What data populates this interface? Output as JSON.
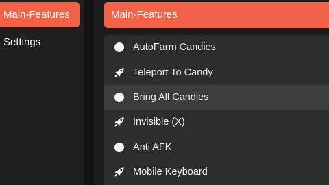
{
  "sidebar": {
    "items": [
      {
        "label": "Main-Features",
        "active": true
      },
      {
        "label": "Settings",
        "active": false
      }
    ]
  },
  "main": {
    "header": "Main-Features",
    "rows": [
      {
        "label": "AutoFarm Candies",
        "icon": "toggle-circle-icon"
      },
      {
        "label": "Teleport To Candy",
        "icon": "rocket-icon"
      },
      {
        "label": "Bring All Candies",
        "icon": "toggle-circle-icon"
      },
      {
        "label": "Invisible (X)",
        "icon": "rocket-icon"
      },
      {
        "label": "Anti AFK",
        "icon": "toggle-circle-icon"
      },
      {
        "label": "Mobile Keyboard",
        "icon": "rocket-icon"
      }
    ]
  },
  "colors": {
    "accent": "#f26248",
    "sidebar_bg": "#1f1f1f",
    "panel_bg": "#2d2d2d",
    "row_hover": "#3d3d3d"
  }
}
